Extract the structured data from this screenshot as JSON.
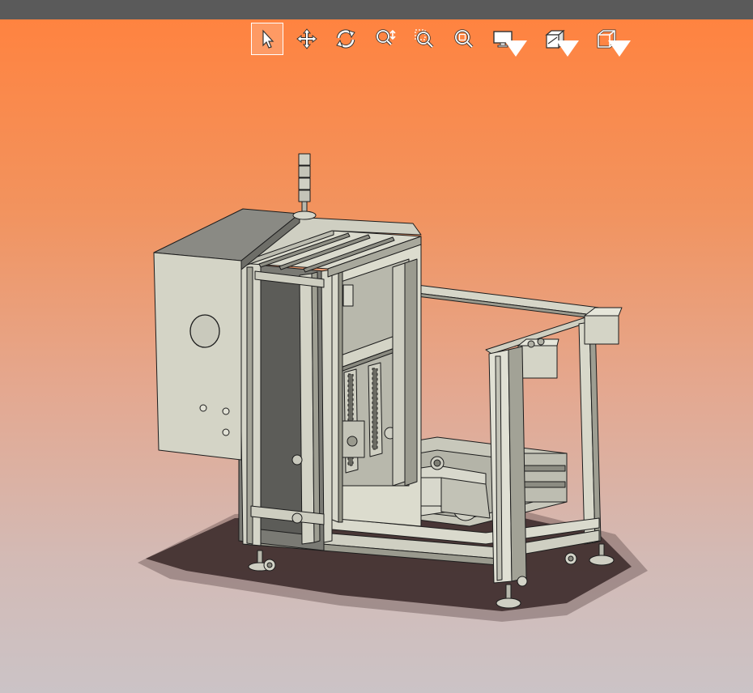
{
  "window": {
    "titlebar_color": "#5a5a5a"
  },
  "viewport": {
    "gradient_top": "#ff8340",
    "gradient_bottom": "#cbc3c6"
  },
  "toolbar": {
    "buttons": [
      {
        "name": "select",
        "icon": "cursor-icon",
        "active": true
      },
      {
        "name": "pan",
        "icon": "move-arrows-icon"
      },
      {
        "name": "rotate",
        "icon": "rotate-icon"
      },
      {
        "name": "zoom",
        "icon": "zoom-in-out-icon"
      },
      {
        "name": "zoom-area",
        "icon": "zoom-box-icon"
      },
      {
        "name": "zoom-fit",
        "icon": "zoom-fit-icon"
      },
      {
        "name": "display-mode",
        "icon": "monitor-icon",
        "dropdown": true
      },
      {
        "name": "section-view",
        "icon": "section-box-icon",
        "dropdown": true
      },
      {
        "name": "view-orientation",
        "icon": "cube-icon",
        "dropdown": true
      }
    ]
  },
  "model": {
    "type": "3d-assembly",
    "body_color": "#d4d4c4",
    "edge_color": "#1a1a1a"
  }
}
